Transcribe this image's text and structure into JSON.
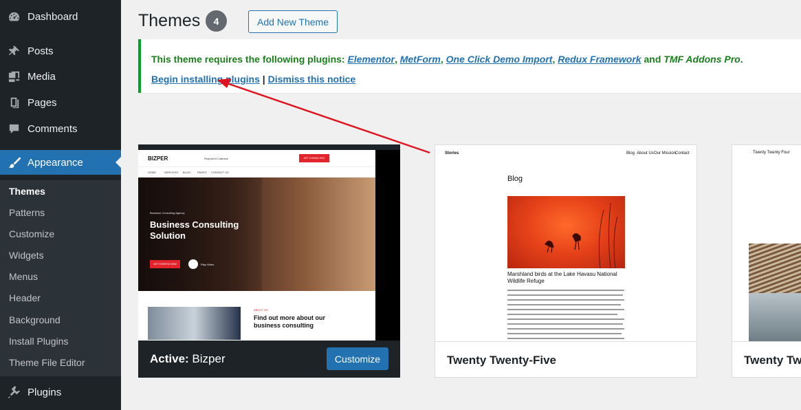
{
  "sidebar": {
    "items": [
      {
        "label": "Dashboard",
        "icon": "dashboard-icon"
      },
      {
        "label": "Posts",
        "icon": "pin-icon"
      },
      {
        "label": "Media",
        "icon": "media-icon"
      },
      {
        "label": "Pages",
        "icon": "pages-icon"
      },
      {
        "label": "Comments",
        "icon": "comments-icon"
      },
      {
        "label": "Appearance",
        "icon": "paintbrush-icon"
      },
      {
        "label": "Plugins",
        "icon": "plugin-icon"
      }
    ],
    "submenu": [
      "Themes",
      "Patterns",
      "Customize",
      "Widgets",
      "Menus",
      "Header",
      "Background",
      "Install Plugins",
      "Theme File Editor"
    ]
  },
  "header": {
    "title": "Themes",
    "count": "4",
    "add_new_label": "Add New Theme"
  },
  "notice": {
    "prefix": "This theme requires the following plugins:",
    "plugins": [
      "Elementor",
      "MetForm",
      "One Click Demo Import",
      "Redux Framework"
    ],
    "and_text": "and",
    "last_plugin": "TMF Addons Pro",
    "begin_label": "Begin installing plugins",
    "separator": "|",
    "dismiss_label": "Dismiss this notice"
  },
  "themes": {
    "active": {
      "active_label": "Active:",
      "name": "Bizper",
      "customize_label": "Customize",
      "preview": {
        "logo": "BIZPER",
        "hero_tag": "Business Consulting Agency",
        "hero_title": "Business Consulting Solution",
        "cta": "GET STARTED NOW",
        "play": "Play Video",
        "about_tag": "ABOUT US",
        "about_title": "Find out more about our business consulting",
        "request": "Request A Callback",
        "consult_btn": "GET CONSULTING",
        "nav": [
          "HOME",
          "SERVICES",
          "BLOG",
          "PAGES",
          "CONTACT US"
        ]
      }
    },
    "tt5": {
      "name": "Twenty Twenty-Five",
      "preview": {
        "site": "Stories",
        "nav": [
          "Blog",
          "About Us",
          "Our Mission",
          "Contact"
        ],
        "heading": "Blog",
        "caption": "Marshland birds at the Lake Havasu National Wildlife Refuge"
      }
    },
    "tt4": {
      "name": "Twenty Twe",
      "preview": {
        "site": "Twenty Twenty Four"
      }
    }
  },
  "colors": {
    "sidebar_bg": "#1d2327",
    "accent": "#2271b1",
    "notice_border": "#00a32a",
    "arrow": "#e0141e"
  }
}
